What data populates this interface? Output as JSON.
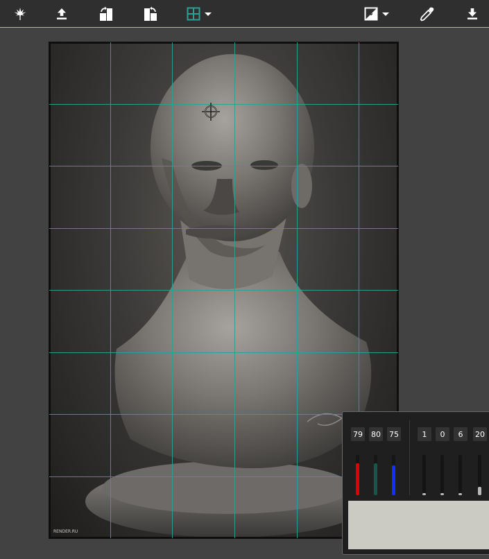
{
  "toolbar": {
    "buttons": [
      {
        "name": "leaf-icon"
      },
      {
        "name": "upload-icon"
      },
      {
        "name": "rotate-right-icon"
      },
      {
        "name": "rotate-left-icon"
      },
      {
        "name": "grid-icon"
      },
      {
        "name": "contrast-icon"
      },
      {
        "name": "eyedropper-icon"
      },
      {
        "name": "download-icon"
      }
    ],
    "accent_color": "#2aa198"
  },
  "canvas": {
    "grid_color": "#2aa198",
    "logo_text": "RENDER.RU"
  },
  "color_panel": {
    "rgb": [
      {
        "label": "79",
        "value": 79,
        "color": "#e00000"
      },
      {
        "label": "80",
        "value": 80,
        "color": "#0f5a4a"
      },
      {
        "label": "75",
        "value": 75,
        "color": "#1a2bff"
      }
    ],
    "extra": [
      {
        "label": "1",
        "value": 1
      },
      {
        "label": "0",
        "value": 0
      },
      {
        "label": "6",
        "value": 6
      },
      {
        "label": "20",
        "value": 20
      }
    ],
    "swatch_color": "#cbcbc3"
  }
}
